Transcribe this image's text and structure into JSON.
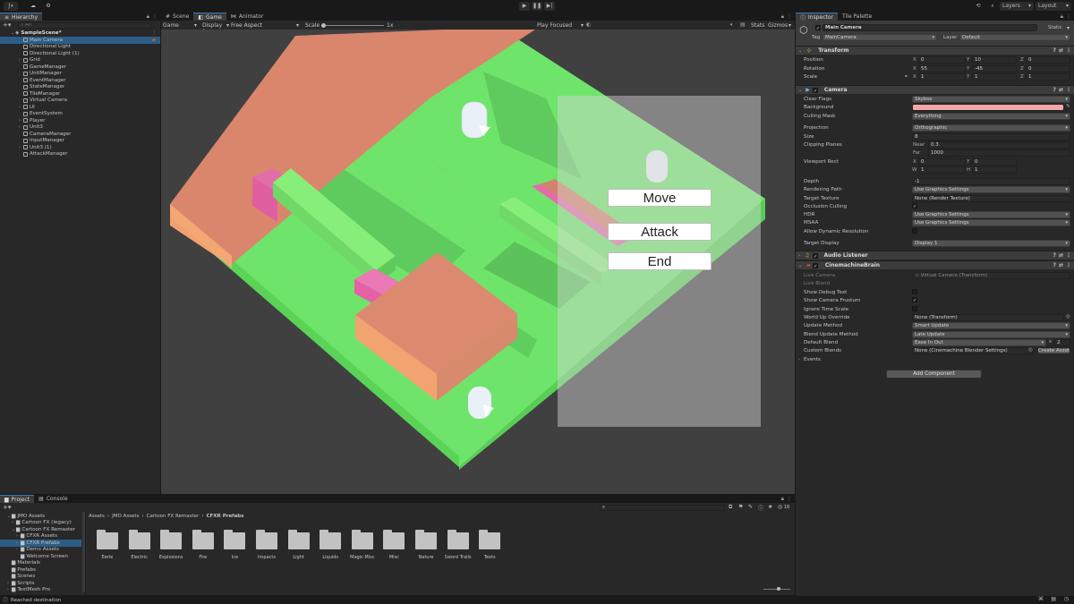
{
  "toolbar": {
    "account_label": "J",
    "layers_label": "Layers",
    "layout_label": "Layout"
  },
  "hierarchy": {
    "tab_label": "Hierarchy",
    "search_placeholder": "All",
    "scene_name": "SampleScene*",
    "items": [
      {
        "label": "Main Camera",
        "expand": ""
      },
      {
        "label": "Directional Light",
        "expand": ""
      },
      {
        "label": "Directional Light (1)",
        "expand": ""
      },
      {
        "label": "Grid",
        "expand": "›"
      },
      {
        "label": "GameManager",
        "expand": ""
      },
      {
        "label": "UnitManager",
        "expand": ""
      },
      {
        "label": "EventManager",
        "expand": ""
      },
      {
        "label": "StateManager",
        "expand": ""
      },
      {
        "label": "TileManager",
        "expand": ""
      },
      {
        "label": "Virtual Camera",
        "expand": ""
      },
      {
        "label": "UI",
        "expand": "›"
      },
      {
        "label": "EventSystem",
        "expand": ""
      },
      {
        "label": "Player",
        "expand": "›"
      },
      {
        "label": "Unit3",
        "expand": "›"
      },
      {
        "label": "CameraManager",
        "expand": ""
      },
      {
        "label": "InputManager",
        "expand": ""
      },
      {
        "label": "Unit3 (1)",
        "expand": "›"
      },
      {
        "label": "AttackManager",
        "expand": ""
      }
    ]
  },
  "center": {
    "tabs": [
      "Scene",
      "Game",
      "Animator"
    ],
    "game_toolbar": {
      "mode": "Game",
      "display": "Display 1",
      "aspect": "Free Aspect",
      "scale_label": "Scale",
      "scale_value": "1x",
      "play_mode": "Play Focused",
      "stats": "Stats",
      "gizmos": "Gizmos"
    },
    "action_menu": [
      "Move",
      "Attack",
      "End"
    ]
  },
  "project": {
    "tabs": [
      "Project",
      "Console"
    ],
    "tree": [
      {
        "label": "JMO Assets",
        "indent": 1,
        "expand": "⌄"
      },
      {
        "label": "Cartoon FX (legacy)",
        "indent": 2,
        "expand": "›"
      },
      {
        "label": "Cartoon FX Remaster",
        "indent": 2,
        "expand": "⌄"
      },
      {
        "label": "CFXR Assets",
        "indent": 3,
        "expand": "›"
      },
      {
        "label": "CFXR Prefabs",
        "indent": 3,
        "expand": "›"
      },
      {
        "label": "Demo Assets",
        "indent": 3,
        "expand": "›"
      },
      {
        "label": "Welcome Screen",
        "indent": 3,
        "expand": ""
      },
      {
        "label": "Materials",
        "indent": 1,
        "expand": ""
      },
      {
        "label": "Prefabs",
        "indent": 1,
        "expand": ""
      },
      {
        "label": "Scenes",
        "indent": 1,
        "expand": ""
      },
      {
        "label": "Scripts",
        "indent": 1,
        "expand": "›"
      },
      {
        "label": "TextMesh Pro",
        "indent": 1,
        "expand": "›"
      }
    ],
    "breadcrumb": [
      "Assets",
      "JMO Assets",
      "Cartoon FX Remaster",
      "CFXR Prefabs"
    ],
    "visibility_count": "16",
    "folders": [
      "Eerie",
      "Electric",
      "Explosions",
      "Fire",
      "Ice",
      "Impacts",
      "Light",
      "Liquids",
      "Magic Misc",
      "Misc",
      "Nature",
      "Sword Trails",
      "Texts"
    ]
  },
  "status_bar": {
    "message": "Reached destination"
  },
  "inspector": {
    "tabs": [
      "Inspector",
      "Tile Palette"
    ],
    "object_name": "Main Camera",
    "static_label": "Static",
    "tag_label": "Tag",
    "tag_value": "MainCamera",
    "layer_label": "Layer",
    "layer_value": "Default",
    "transform": {
      "title": "Transform",
      "position_label": "Position",
      "rotation_label": "Rotation",
      "scale_label": "Scale",
      "position": {
        "x": "0",
        "y": "10",
        "z": "0"
      },
      "rotation": {
        "x": "55",
        "y": "-45",
        "z": "0"
      },
      "scale": {
        "x": "1",
        "y": "1",
        "z": "1"
      }
    },
    "camera": {
      "title": "Camera",
      "clear_flags_label": "Clear Flags",
      "clear_flags": "Skybox",
      "background_label": "Background",
      "background_color": "#f4a6a6",
      "culling_mask_label": "Culling Mask",
      "culling_mask": "Everything",
      "projection_label": "Projection",
      "projection": "Orthographic",
      "size_label": "Size",
      "size": "8",
      "clipping_label": "Clipping Planes",
      "near_label": "Near",
      "near": "0.3",
      "far_label": "Far",
      "far": "1000",
      "viewport_label": "Viewport Rect",
      "viewport": {
        "x": "0",
        "y": "0",
        "w": "1",
        "h": "1"
      },
      "depth_label": "Depth",
      "depth": "-1",
      "rendering_path_label": "Rendering Path",
      "rendering_path": "Use Graphics Settings",
      "target_texture_label": "Target Texture",
      "target_texture": "None (Render Texture)",
      "occlusion_label": "Occlusion Culling",
      "hdr_label": "HDR",
      "hdr": "Use Graphics Settings",
      "msaa_label": "MSAA",
      "msaa": "Use Graphics Settings",
      "dyn_res_label": "Allow Dynamic Resolution",
      "target_display_label": "Target Display",
      "target_display": "Display 1"
    },
    "audio_listener": {
      "title": "Audio Listener"
    },
    "brain": {
      "title": "CinemachineBrain",
      "live_camera_label": "Live Camera",
      "live_camera": "Virtual Camera (Transform)",
      "live_blend_label": "Live Blend",
      "show_debug_label": "Show Debug Text",
      "show_frustum_label": "Show Camera Frustum",
      "ignore_ts_label": "Ignore Time Scale",
      "world_up_label": "World Up Override",
      "world_up": "None (Transform)",
      "update_method_label": "Update Method",
      "update_method": "Smart Update",
      "blend_update_label": "Blend Update Method",
      "blend_update": "Late Update",
      "default_blend_label": "Default Blend",
      "default_blend": "Ease In Out",
      "default_blend_s": "s",
      "default_blend_time": "2",
      "custom_blends_label": "Custom Blends",
      "custom_blends": "None (Cinemachine Blender Settings)",
      "create_asset": "Create Asset",
      "events_label": "Events"
    },
    "add_component": "Add Component"
  }
}
